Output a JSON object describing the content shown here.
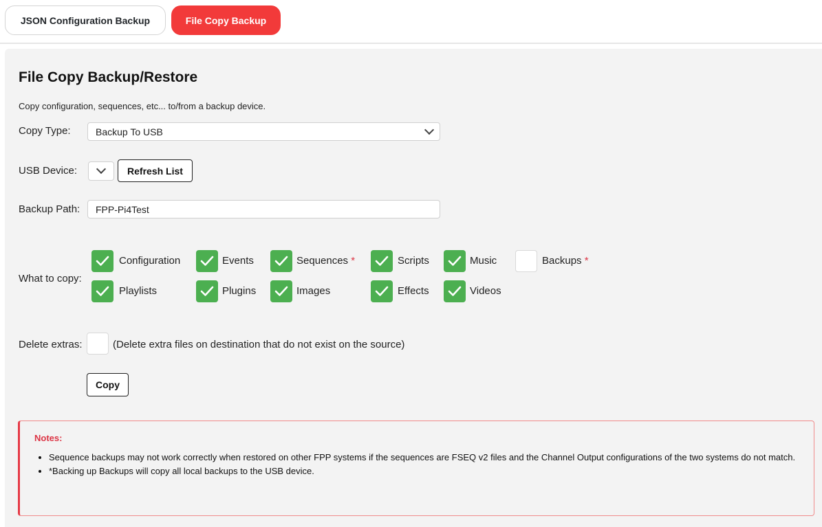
{
  "tabs": {
    "json_label": "JSON Configuration Backup",
    "file_label": "File Copy Backup"
  },
  "panel": {
    "title": "File Copy Backup/Restore",
    "subtitle": "Copy configuration, sequences, etc... to/from a backup device."
  },
  "copy_type": {
    "label": "Copy Type:",
    "selected": "Backup To USB"
  },
  "usb_device": {
    "label": "USB Device:",
    "selected": "",
    "refresh_label": "Refresh List"
  },
  "backup_path": {
    "label": "Backup Path:",
    "value": "FPP-Pi4Test"
  },
  "what_to_copy": {
    "label": "What to copy:",
    "items": [
      {
        "label": "Configuration",
        "checked": true,
        "required_mark": ""
      },
      {
        "label": "Events",
        "checked": true,
        "required_mark": ""
      },
      {
        "label": "Sequences",
        "checked": true,
        "required_mark": "*"
      },
      {
        "label": "Scripts",
        "checked": true,
        "required_mark": ""
      },
      {
        "label": "Music",
        "checked": true,
        "required_mark": ""
      },
      {
        "label": "Backups",
        "checked": false,
        "required_mark": "*"
      },
      {
        "label": "Playlists",
        "checked": true,
        "required_mark": ""
      },
      {
        "label": "Plugins",
        "checked": true,
        "required_mark": ""
      },
      {
        "label": "Images",
        "checked": true,
        "required_mark": ""
      },
      {
        "label": "Effects",
        "checked": true,
        "required_mark": ""
      },
      {
        "label": "Videos",
        "checked": true,
        "required_mark": ""
      }
    ]
  },
  "delete_extras": {
    "label": "Delete extras:",
    "checked": false,
    "description": "(Delete extra files on destination that do not exist on the source)"
  },
  "copy_button_label": "Copy",
  "notes": {
    "title": "Notes:",
    "items": [
      "Sequence backups may not work correctly when restored on other FPP systems if the sequences are FSEQ v2 files and the Channel Output configurations of the two systems do not match.",
      "*Backing up Backups will copy all local backups to the USB device."
    ]
  },
  "colors": {
    "accent": "#f23a3a",
    "checkbox_checked": "#4caf50",
    "notes_border": "#e63946"
  }
}
